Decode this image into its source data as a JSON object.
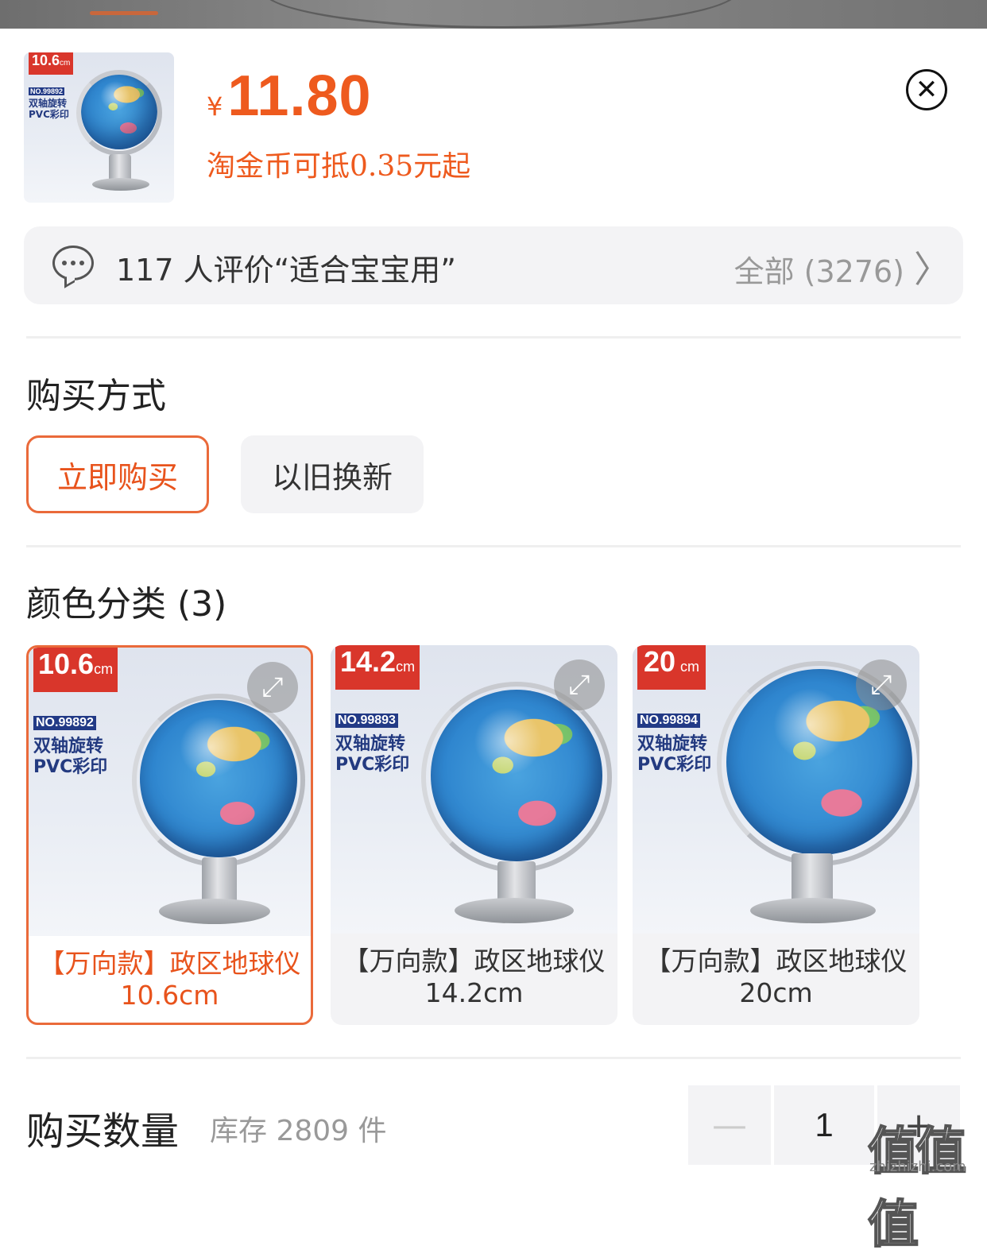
{
  "product": {
    "thumb": {
      "size": "10.6",
      "unit": "cm",
      "model": "NO.99892",
      "feature1": "双轴旋转",
      "feature2": "PVC彩印"
    },
    "currency": "¥",
    "price": "11.80",
    "coin_note": "淘金币可抵0.35元起"
  },
  "reviews": {
    "summary": "117 人评价“适合宝宝用”",
    "all_label": "全部 (3276)"
  },
  "purchase_method": {
    "title": "购买方式",
    "options": [
      "立即购买",
      "以旧换新"
    ],
    "selected": "立即购买"
  },
  "color_category": {
    "title": "颜色分类 (3)",
    "items": [
      {
        "badge_size": "10.6",
        "badge_unit": "cm",
        "model": "NO.99892",
        "feature1": "双轴旋转",
        "feature2": "PVC彩印",
        "name": "【万向款】政区地球仪",
        "size": "10.6cm",
        "selected": true
      },
      {
        "badge_size": "14.2",
        "badge_unit": "cm",
        "model": "NO.99893",
        "feature1": "双轴旋转",
        "feature2": "PVC彩印",
        "name": "【万向款】政区地球仪",
        "size": "14.2cm",
        "selected": false
      },
      {
        "badge_size": "20",
        "badge_unit": "cm",
        "model": "NO.99894",
        "feature1": "双轴旋转",
        "feature2": "PVC彩印",
        "name": "【万向款】政区地球仪",
        "size": "20cm",
        "selected": false
      }
    ]
  },
  "quantity": {
    "title": "购买数量",
    "stock": "库存 2809 件",
    "value": "1",
    "minus": "—",
    "plus": "+"
  },
  "icons": {
    "close": "close-circle-icon",
    "chat": "chat-bubble-icon",
    "chevron": "chevron-right-icon",
    "expand": "expand-icon"
  },
  "colors": {
    "accent": "#ee5a1e",
    "border_selected": "#ea6a3a",
    "chip_bg": "#f3f3f5",
    "badge_red": "#d9362b"
  },
  "watermark": {
    "main": "值值值",
    "sub": "zhizhizhi.com"
  }
}
